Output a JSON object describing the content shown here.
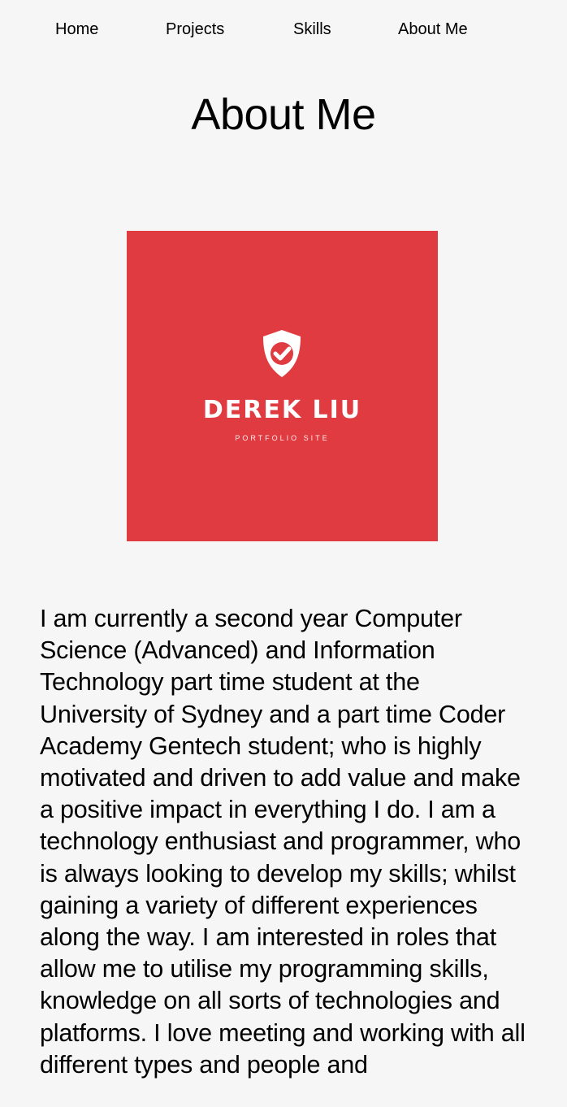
{
  "nav": {
    "items": [
      {
        "label": "Home"
      },
      {
        "label": "Projects"
      },
      {
        "label": "Skills"
      },
      {
        "label": "About Me"
      }
    ]
  },
  "page": {
    "title": "About Me"
  },
  "logo": {
    "icon": "shield-check-icon",
    "name": "DEREK LIU",
    "subtitle": "PORTFOLIO SITE",
    "background": "#e03b40"
  },
  "bio": {
    "text": "I am currently a second year Computer Science (Advanced) and Information Technology part time student at the University of Sydney and a part time Coder Academy Gentech student; who is highly motivated and driven to add value and make a positive impact in everything I do. I am a technology enthusiast and programmer, who is always looking to develop my skills; whilst gaining a variety of different experiences along the way. I am interested in roles that allow me to utilise my programming skills, knowledge on all sorts of technologies and platforms. I love meeting and working with all different types and people and"
  }
}
